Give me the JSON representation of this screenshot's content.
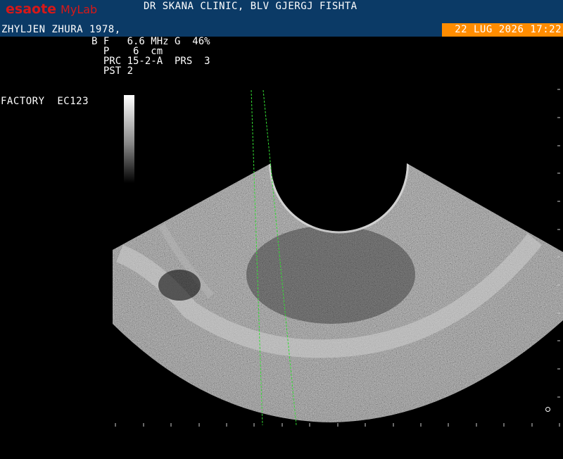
{
  "header": {
    "logo_brand": "esaote",
    "logo_product": "MyLab",
    "clinic": "DR SKANA CLINIC, BLV GJERGJ FISHTA",
    "patient": "ZHYLJEN ZHURA 1978,",
    "datetime": "22 LUG 2026 17:22"
  },
  "params": {
    "line1": "B F   6.6 MHz G  46%",
    "line2": "  P    6  cm",
    "line3": "  PRC 15-2-A  PRS  3",
    "line4": "  PST 2"
  },
  "preset": {
    "label": "FACTORY",
    "probe": "EC123"
  },
  "colors": {
    "header_bg": "#0b3a66",
    "date_bg": "#ff8c00",
    "logo_red": "#d81818",
    "guide_green": "#33dd33"
  }
}
